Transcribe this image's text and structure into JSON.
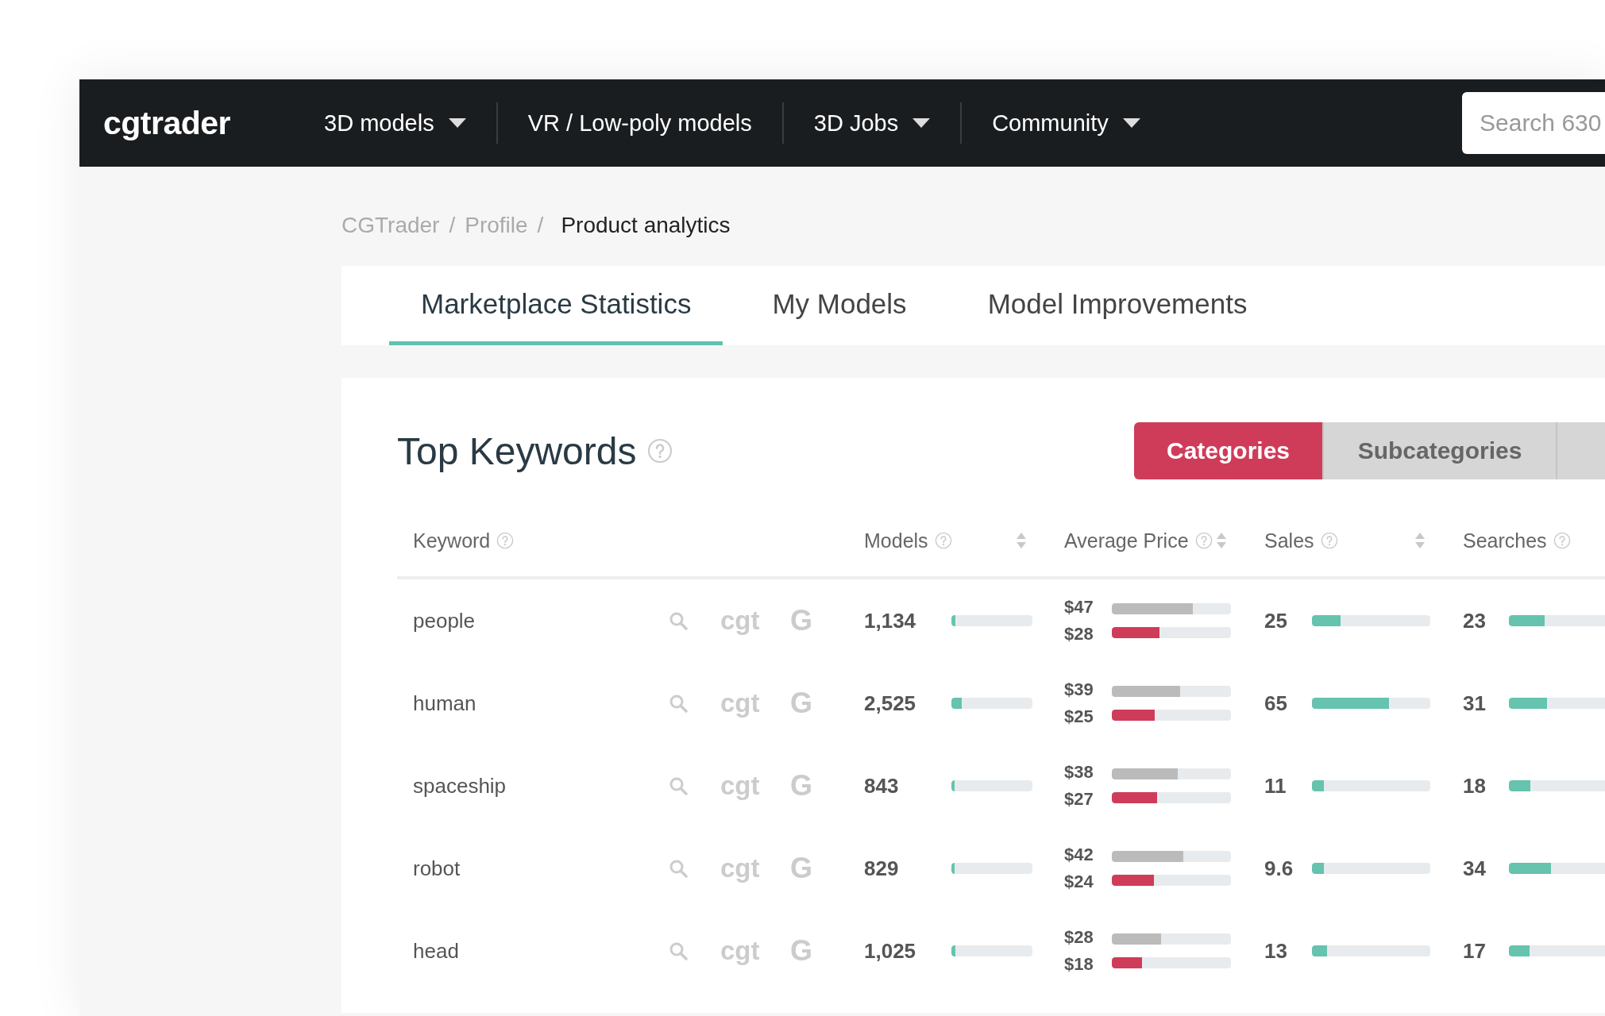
{
  "logo": "cgtrader",
  "nav": [
    {
      "label": "3D models",
      "dropdown": true
    },
    {
      "label": "VR / Low-poly models",
      "dropdown": false
    },
    {
      "label": "3D Jobs",
      "dropdown": true
    },
    {
      "label": "Community",
      "dropdown": true
    }
  ],
  "search": {
    "placeholder": "Search 630"
  },
  "breadcrumb": {
    "separator": "/",
    "items": [
      {
        "label": "CGTrader",
        "current": false
      },
      {
        "label": "Profile",
        "current": false
      },
      {
        "label": "Product analytics",
        "current": true
      }
    ]
  },
  "tabs": [
    {
      "label": "Marketplace Statistics",
      "selected": true
    },
    {
      "label": "My Models",
      "selected": false
    },
    {
      "label": "Model Improvements",
      "selected": false
    }
  ],
  "section": {
    "title": "Top Keywords",
    "toggle": [
      {
        "label": "Categories",
        "selected": true
      },
      {
        "label": "Subcategories",
        "selected": false
      }
    ]
  },
  "table": {
    "columns": [
      {
        "label": "Keyword",
        "sortable": false
      },
      {
        "label": "Models",
        "sortable": true
      },
      {
        "label": "Average Price",
        "sortable": true
      },
      {
        "label": "Sales",
        "sortable": true
      },
      {
        "label": "Searches"
      }
    ],
    "rows": [
      {
        "keyword": "people",
        "site_link": "cgt",
        "google_link": "G",
        "models": {
          "text": "1,134",
          "level": 0.05
        },
        "price_max": {
          "text": "$47",
          "level": 0.68
        },
        "price_avg": {
          "text": "$28",
          "level": 0.4
        },
        "sales": {
          "text": "25",
          "level": 0.24
        },
        "searches": {
          "text": "23",
          "level": 0.3
        }
      },
      {
        "keyword": "human",
        "site_link": "cgt",
        "google_link": "G",
        "models": {
          "text": "2,525",
          "level": 0.13
        },
        "price_max": {
          "text": "$39",
          "level": 0.57
        },
        "price_avg": {
          "text": "$25",
          "level": 0.36
        },
        "sales": {
          "text": "65",
          "level": 0.65
        },
        "searches": {
          "text": "31",
          "level": 0.32
        }
      },
      {
        "keyword": "spaceship",
        "site_link": "cgt",
        "google_link": "G",
        "models": {
          "text": "843",
          "level": 0.04
        },
        "price_max": {
          "text": "$38",
          "level": 0.55
        },
        "price_avg": {
          "text": "$27",
          "level": 0.38
        },
        "sales": {
          "text": "11",
          "level": 0.1
        },
        "searches": {
          "text": "18",
          "level": 0.18
        }
      },
      {
        "keyword": "robot",
        "site_link": "cgt",
        "google_link": "G",
        "models": {
          "text": "829",
          "level": 0.04
        },
        "price_max": {
          "text": "$42",
          "level": 0.6
        },
        "price_avg": {
          "text": "$24",
          "level": 0.35
        },
        "sales": {
          "text": "9.6",
          "level": 0.1
        },
        "searches": {
          "text": "34",
          "level": 0.35
        }
      },
      {
        "keyword": "head",
        "site_link": "cgt",
        "google_link": "G",
        "models": {
          "text": "1,025",
          "level": 0.05
        },
        "price_max": {
          "text": "$28",
          "level": 0.41
        },
        "price_avg": {
          "text": "$18",
          "level": 0.25
        },
        "sales": {
          "text": "13",
          "level": 0.13
        },
        "searches": {
          "text": "17",
          "level": 0.17
        }
      }
    ]
  }
}
